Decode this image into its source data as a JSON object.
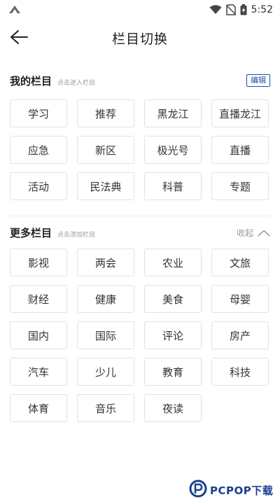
{
  "status": {
    "time": "5:52"
  },
  "header": {
    "title": "栏目切换"
  },
  "my_columns": {
    "title": "我的栏目",
    "hint": "点击进入栏目",
    "edit_label": "编辑",
    "items": [
      "学习",
      "推荐",
      "黑龙江",
      "直播龙江",
      "应急",
      "新区",
      "极光号",
      "直播",
      "活动",
      "民法典",
      "科普",
      "专题"
    ]
  },
  "more_columns": {
    "title": "更多栏目",
    "hint": "点击添加栏目",
    "collapse_label": "收起",
    "items": [
      "影视",
      "两会",
      "农业",
      "文旅",
      "财经",
      "健康",
      "美食",
      "母婴",
      "国内",
      "国际",
      "评论",
      "房产",
      "汽车",
      "少儿",
      "教育",
      "科技",
      "体育",
      "音乐",
      "夜读"
    ]
  },
  "watermark": {
    "text": "PCPOP下载"
  },
  "colors": {
    "accent": "#1f4fa6",
    "chip_border": "#e2e2e2",
    "hint": "#999999"
  }
}
